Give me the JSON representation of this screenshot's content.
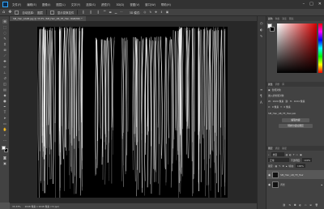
{
  "menubar": {
    "items": [
      "文件(F)",
      "编辑(E)",
      "图像(I)",
      "图层(L)",
      "文字(Y)",
      "选择(S)",
      "滤镜(T)",
      "3D(D)",
      "视图(V)",
      "窗口(W)",
      "帮助(H)"
    ],
    "window_controls": [
      "–",
      "□",
      "✕"
    ]
  },
  "options": {
    "auto_select_label": "自动选择:",
    "auto_select_value": "图层",
    "transform_label": "显示变换控件",
    "mode_3d_label": "3D 模式:"
  },
  "tabs": [
    {
      "label": "SM_Hair_CA08.jpg @ 33.3% (SM_Hair_AB_TE_Hair, RGB/8#) *",
      "active": true
    },
    {
      "label": "…",
      "active": false
    }
  ],
  "status": {
    "zoom": "33.33%",
    "doc_info": "2048 像素 x 2048 像素 (72 ppi)"
  },
  "panels": {
    "color_tabs": [
      "颜色",
      "色板",
      "渐变",
      "图案"
    ],
    "color_accent": "#d40000",
    "properties_tabs": [
      "属性",
      "调整",
      "库"
    ],
    "properties_title": "智能对象",
    "smart_object_label": "嵌入的智能对象",
    "w_label": "W:",
    "w_value": "1024 像素",
    "h_label": "H:",
    "h_value": "1024 像素",
    "x_label": "X:",
    "x_value": "0 像素",
    "y_label": "Y:",
    "y_value": "0 像素",
    "file_name": "SM_Hair_AB_TE_Hair.psb",
    "edit_button": "编辑内容",
    "convert_button": "转换为链接图层",
    "layers_tabs": [
      "图层",
      "通道",
      "路径"
    ],
    "search_label": "类型",
    "blend_mode": "正常",
    "opacity_label": "不透明度:",
    "opacity_value": "100%",
    "lock_label": "锁定:",
    "fill_label": "填充:",
    "fill_value": "100%",
    "layers": [
      {
        "name": "SM_Hair_AB_TE_Hair",
        "selected": true
      },
      {
        "name": "背景",
        "selected": false
      }
    ]
  }
}
